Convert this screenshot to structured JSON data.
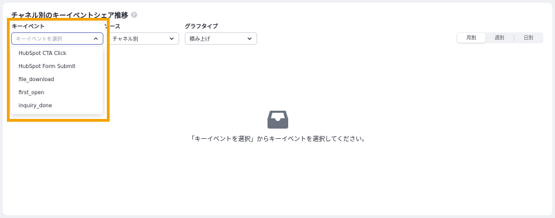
{
  "panel": {
    "title": "チャネル別のキーイベントシェア推移",
    "help_glyph": "?"
  },
  "filters": {
    "key_event": {
      "label": "キーイベント",
      "placeholder": "キーイベントを選択",
      "options": [
        "HubSpot CTA Click",
        "HubSpot Form Submit",
        "file_download",
        "first_open",
        "inquiry_done"
      ]
    },
    "source": {
      "label": "ソース",
      "value": "チャネル別"
    },
    "graph_type": {
      "label": "グラフタイプ",
      "value": "積み上げ"
    }
  },
  "period_toggle": {
    "options": [
      "月別",
      "週別",
      "日別"
    ],
    "selected": "月別"
  },
  "empty_state": {
    "icon": "inbox-tray-icon",
    "message": "「キーイベントを選択」からキーイベントを選択してください。"
  },
  "colors": {
    "highlight_border": "#f5a300",
    "active_select_border": "#7a86c8",
    "empty_icon": "#6b7280"
  }
}
